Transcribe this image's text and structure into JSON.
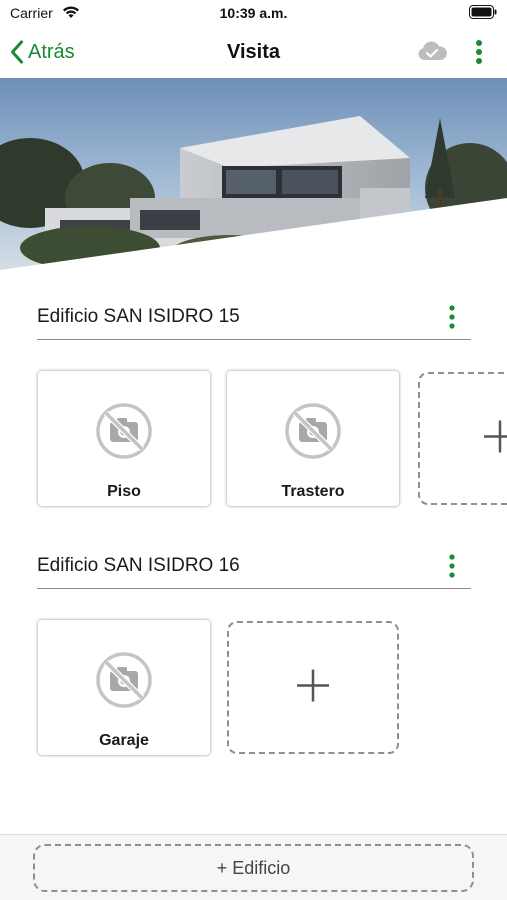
{
  "status_bar": {
    "carrier": "Carrier",
    "time": "10:39 a.m."
  },
  "nav": {
    "back_label": "Atrás",
    "title": "Visita"
  },
  "colors": {
    "accent": "#1a8a34",
    "dashed_border": "#8f8f8f",
    "divider": "#8a8a8a"
  },
  "buildings": [
    {
      "name": "Edificio SAN ISIDRO 15",
      "units": [
        {
          "label": "Piso",
          "icon": "no-photo-icon"
        },
        {
          "label": "Trastero",
          "icon": "no-photo-icon"
        }
      ],
      "add_icon": "plus-icon"
    },
    {
      "name": "Edificio SAN ISIDRO 16",
      "units": [
        {
          "label": "Garaje",
          "icon": "no-photo-icon"
        }
      ],
      "add_icon": "plus-icon"
    }
  ],
  "footer": {
    "add_building_label": "+ Edificio"
  }
}
